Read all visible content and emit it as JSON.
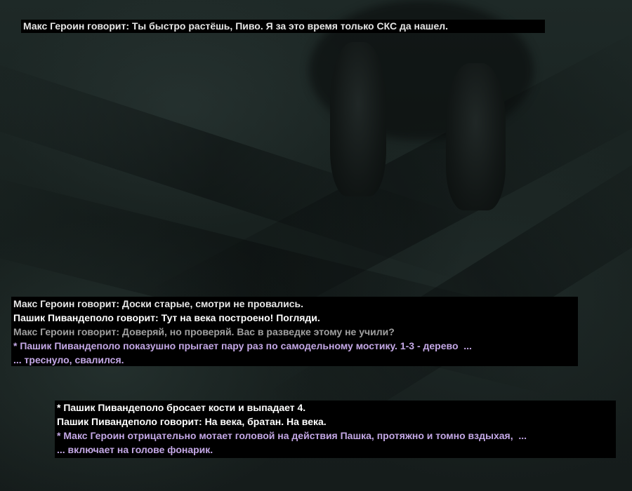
{
  "colors": {
    "say_light": "#e6e6e6",
    "say_white": "#ffffff",
    "say_dim": "#a0a0a0",
    "action": "#c4a8e6",
    "box_bg": "#000000"
  },
  "chat_top": {
    "line": "Макс Героин говорит: Ты быстро растёшь, Пиво. Я за это время только СКС да нашел."
  },
  "chat_middle": {
    "lines": [
      "Макс Героин говорит: Доски старые, смотри не провались.",
      "Пашик Пивандеполо говорит: Тут на века построено! Погляди.",
      "Макс Героин говорит: Доверяй, но проверяй. Вас в разведке этому не учили?",
      "* Пашик Пивандеполо показушно прыгает пару раз по самодельному мостику. 1-3 - дерево  ...",
      "... треснуло, свалился."
    ]
  },
  "chat_bottom": {
    "lines": [
      "* Пашик Пивандеполо бросает кости и выпадает 4.",
      "Пашик Пивандеполо говорит: На века, братан. На века.",
      "* Макс Героин отрицательно мотает головой на действия Пашка, протяжно и томно вздыхая,  ...",
      "... включает на голове фонарик."
    ]
  }
}
